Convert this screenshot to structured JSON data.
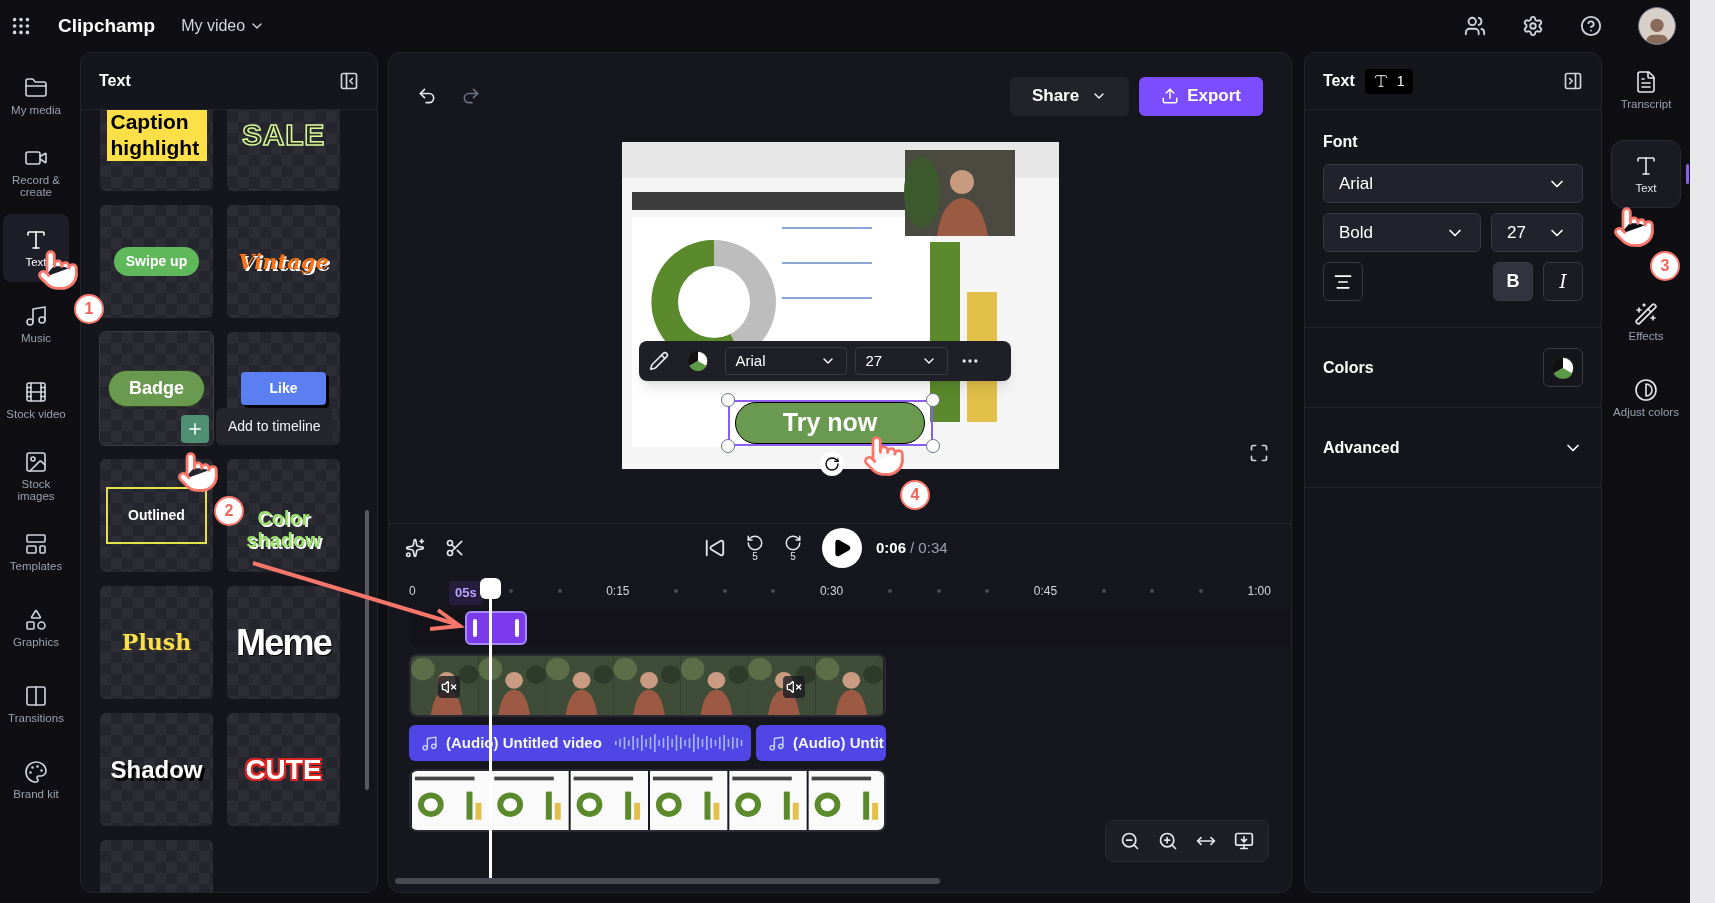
{
  "app": {
    "name": "Clipchamp",
    "project": "My video"
  },
  "rail": [
    {
      "label": "My media",
      "selected": false
    },
    {
      "label": "Record & create",
      "selected": false
    },
    {
      "label": "Text",
      "selected": true
    },
    {
      "label": "Music",
      "selected": false
    },
    {
      "label": "Stock video",
      "selected": false
    },
    {
      "label": "Stock images",
      "selected": false
    },
    {
      "label": "Templates",
      "selected": false
    },
    {
      "label": "Graphics",
      "selected": false
    },
    {
      "label": "Transitions",
      "selected": false
    },
    {
      "label": "Brand kit",
      "selected": false
    }
  ],
  "text_panel": {
    "title": "Text",
    "tooltip": "Add to timeline",
    "styles": [
      {
        "label": "Caption highlight",
        "kind": "caption",
        "hovered": false
      },
      {
        "label": "SALE",
        "kind": "sale",
        "hovered": false
      },
      {
        "label": "Swipe up",
        "kind": "swipe",
        "hovered": false
      },
      {
        "label": "Vintage",
        "kind": "vintage",
        "hovered": false
      },
      {
        "label": "Badge",
        "kind": "badge",
        "hovered": true
      },
      {
        "label": "Like",
        "kind": "like",
        "hovered": false
      },
      {
        "label": "Outlined",
        "kind": "outlined",
        "hovered": false
      },
      {
        "label": "Color shadow",
        "kind": "color_shadow",
        "hovered": false
      },
      {
        "label": "Plush",
        "kind": "plush",
        "hovered": false
      },
      {
        "label": "Meme",
        "kind": "meme",
        "hovered": false
      },
      {
        "label": "Shadow",
        "kind": "shadow",
        "hovered": false
      },
      {
        "label": "CUTE",
        "kind": "cute",
        "hovered": false
      },
      {
        "kind": "blank",
        "hovered": false
      }
    ]
  },
  "editor": {
    "share": "Share",
    "export": "Export",
    "toolbar": {
      "font": "Arial",
      "size": "27"
    },
    "overlay_text": "Try now"
  },
  "timeline": {
    "skip_back": "5",
    "skip_forward": "5",
    "current": "0:06",
    "total": "/ 0:34",
    "playhead": "05s",
    "ruler": [
      "0",
      "0:15",
      "0:30",
      "0:45",
      "1:00"
    ],
    "audio_clips": [
      "(Audio) Untitled video",
      "(Audio) Untit"
    ]
  },
  "properties": {
    "title": "Text",
    "count": "1",
    "font_heading": "Font",
    "font": "Arial",
    "weight": "Bold",
    "size": "27",
    "styles": [
      {
        "label": "B",
        "kind": "bold",
        "selected": true
      },
      {
        "label": "I",
        "kind": "italic",
        "selected": false
      }
    ],
    "colors": "Colors",
    "advanced": "Advanced",
    "expanded": false
  },
  "right_rail": [
    {
      "label": "Transcript",
      "selected": false
    },
    {
      "label": "Text",
      "selected": true
    },
    {
      "label": "Effects",
      "selected": false
    },
    {
      "label": "Adjust colors",
      "selected": false
    }
  ],
  "steps": [
    "1",
    "2",
    "3",
    "4"
  ]
}
